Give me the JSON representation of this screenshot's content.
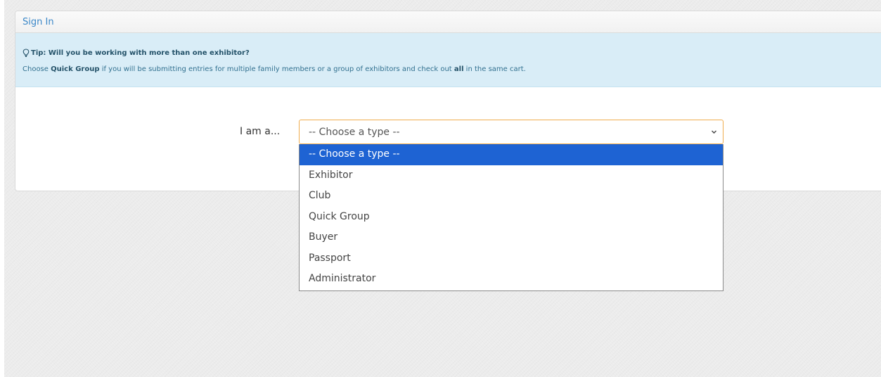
{
  "panel": {
    "title": "Sign In"
  },
  "tip": {
    "icon": "lightbulb-icon",
    "heading": "Tip: Will you be working with more than one exhibitor?",
    "text_before": "Choose ",
    "quick_group": "Quick Group",
    "text_middle": " if you will be submitting entries for multiple family members or a group of exhibitors and check out ",
    "all_word": "all",
    "text_after": " in the same cart."
  },
  "form": {
    "label": "I am a...",
    "selected_value": "-- Choose a type --",
    "options": [
      "-- Choose a type --",
      "Exhibitor",
      "Club",
      "Quick Group",
      "Buyer",
      "Passport",
      "Administrator"
    ]
  },
  "colors": {
    "tip_background": "#d9edf7",
    "select_border": "#f0ad4e",
    "selected_option": "#1e63d3",
    "title_link": "#3a87c8"
  }
}
